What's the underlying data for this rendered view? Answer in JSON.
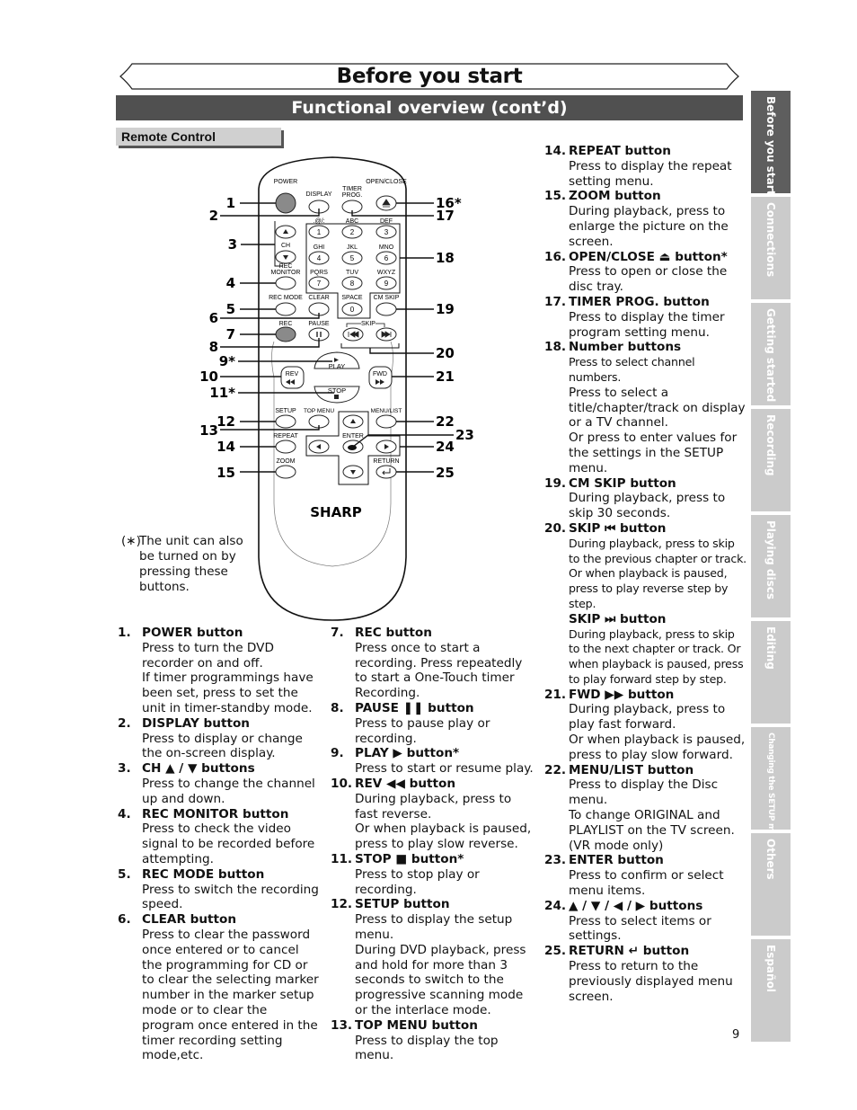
{
  "page": {
    "title": "Before you start",
    "subtitle": "Functional overview (cont’d)",
    "section_label": "Remote Control",
    "page_number": "9"
  },
  "side_tabs": [
    {
      "label": "Before you start",
      "active": true
    },
    {
      "label": "Connections",
      "active": false
    },
    {
      "label": "Getting started",
      "active": false
    },
    {
      "label": "Recording",
      "active": false
    },
    {
      "label": "Playing discs",
      "active": false
    },
    {
      "label": "Editing",
      "active": false
    },
    {
      "label": "Changing the SETUP menu",
      "active": false
    },
    {
      "label": "Others",
      "active": false
    },
    {
      "label": "Español",
      "active": false
    }
  ],
  "remote": {
    "brand": "SHARP",
    "labels": {
      "power": "POWER",
      "display": "DISPLAY",
      "timer": "TIMER",
      "prog": "PROG.",
      "open_close": "OPEN/CLOSE",
      "ch": "CH",
      "rec_monitor_1": "REC",
      "rec_monitor_2": "MONITOR",
      "rec_mode": "REC MODE",
      "clear": "CLEAR",
      "space": "SPACE",
      "cm_skip": "CM SKIP",
      "rec": "REC",
      "pause": "PAUSE",
      "skip": "SKIP",
      "play": "PLAY",
      "rev": "REV",
      "fwd": "FWD",
      "stop": "STOP",
      "setup": "SETUP",
      "top_menu": "TOP MENU",
      "menu_list": "MENU/LIST",
      "repeat": "REPEAT",
      "enter": "ENTER",
      "zoom": "ZOOM",
      "return": "RETURN"
    },
    "keypad": [
      {
        "digit": "1",
        "letters": ".@/:"
      },
      {
        "digit": "2",
        "letters": "ABC"
      },
      {
        "digit": "3",
        "letters": "DEF"
      },
      {
        "digit": "4",
        "letters": "GHI"
      },
      {
        "digit": "5",
        "letters": "JKL"
      },
      {
        "digit": "6",
        "letters": "MNO"
      },
      {
        "digit": "7",
        "letters": "PQRS"
      },
      {
        "digit": "8",
        "letters": "TUV"
      },
      {
        "digit": "9",
        "letters": "WXYZ"
      },
      {
        "digit": "0",
        "letters": "SPACE"
      }
    ],
    "callouts_left": [
      "1",
      "2",
      "3",
      "4",
      "5",
      "6",
      "7",
      "8",
      "9*",
      "10",
      "11*",
      "12",
      "13",
      "14",
      "15"
    ],
    "callouts_right": [
      "16*",
      "17",
      "18",
      "19",
      "20",
      "21",
      "22",
      "23",
      "24",
      "25"
    ]
  },
  "footnote": {
    "mark": "(∗)",
    "text": "The unit can also be turned on by pressing these buttons."
  },
  "items": [
    {
      "num": "1.",
      "head": "POWER button",
      "desc": [
        "Press to turn the DVD recorder on and off.",
        "If timer programmings have been set, press to set the unit in timer-standby mode."
      ]
    },
    {
      "num": "2.",
      "head": "DISPLAY button",
      "desc": [
        "Press to display or change the on-screen display."
      ]
    },
    {
      "num": "3.",
      "head": "CH ▲ / ▼ buttons",
      "desc": [
        "Press to change the channel up and down."
      ]
    },
    {
      "num": "4.",
      "head": "REC MONITOR button",
      "desc": [
        "Press to check the video signal to be recorded before attempting."
      ]
    },
    {
      "num": "5.",
      "head": "REC MODE button",
      "desc": [
        "Press to switch the recording speed."
      ]
    },
    {
      "num": "6.",
      "head": "CLEAR button",
      "desc": [
        "Press to clear the password once entered or to cancel the programming for CD or to clear the selecting marker number in the marker setup mode or to clear the program once entered in the timer recording setting mode,etc."
      ]
    },
    {
      "num": "7.",
      "head": "REC button",
      "desc": [
        "Press once to start a recording. Press repeatedly to start a One-Touch timer Recording."
      ]
    },
    {
      "num": "8.",
      "head": "PAUSE ❚❚ button",
      "desc": [
        "Press to pause play or recording."
      ]
    },
    {
      "num": "9.",
      "head": "PLAY ▶ button*",
      "desc": [
        "Press to start or resume play."
      ]
    },
    {
      "num": "10.",
      "head": "REV ◀◀ button",
      "desc": [
        "During playback, press to fast reverse.",
        "Or when playback is paused, press to play slow reverse."
      ]
    },
    {
      "num": "11.",
      "head": "STOP ■ button*",
      "desc": [
        "Press to stop play or recording."
      ]
    },
    {
      "num": "12.",
      "head": "SETUP button",
      "desc": [
        "Press to display the setup menu.",
        "During DVD playback, press and hold for more than 3 seconds to switch to the progressive scanning mode or the interlace mode."
      ]
    },
    {
      "num": "13.",
      "head": "TOP MENU button",
      "desc": [
        "Press to display the top menu."
      ]
    },
    {
      "num": "14.",
      "head": "REPEAT button",
      "desc": [
        "Press to display the repeat setting menu."
      ]
    },
    {
      "num": "15.",
      "head": "ZOOM button",
      "desc": [
        "During playback, press to enlarge the picture on the screen."
      ]
    },
    {
      "num": "16.",
      "head": "OPEN/CLOSE ⏏ button*",
      "desc": [
        "Press to open or close the disc tray."
      ]
    },
    {
      "num": "17.",
      "head": "TIMER PROG. button",
      "desc": [
        "Press to display the timer program setting menu."
      ]
    },
    {
      "num": "18.",
      "head": "Number buttons",
      "desc_small": "Press to select channel numbers.",
      "desc": [
        "Press to select a title/chapter/track on display or a TV channel.",
        "Or press to enter values for the settings in the SETUP menu."
      ]
    },
    {
      "num": "19.",
      "head": "CM SKIP button",
      "desc": [
        "During playback, press to skip 30 seconds."
      ]
    },
    {
      "num": "20.",
      "head": "SKIP ⏮ button",
      "desc_small": "During playback, press to skip to the previous chapter or track. Or when playback is paused, press to play reverse step by step.",
      "sub_head": "SKIP ⏭ button",
      "sub_desc_small": "During playback, press to skip to the next chapter or track. Or when playback is paused, press to play forward step by step."
    },
    {
      "num": "21.",
      "head": "FWD ▶▶ button",
      "desc": [
        "During playback, press to play fast forward.",
        "Or when playback is paused, press to play slow forward."
      ]
    },
    {
      "num": "22.",
      "head": "MENU/LIST button",
      "desc": [
        "Press to display the Disc menu.",
        "To change ORIGINAL and PLAYLIST on the TV screen. (VR mode only)"
      ]
    },
    {
      "num": "23.",
      "head": "ENTER button",
      "desc": [
        "Press to confirm or select menu items."
      ]
    },
    {
      "num": "24.",
      "head": "▲ / ▼ / ◀ / ▶ buttons",
      "desc": [
        "Press to select items or settings."
      ]
    },
    {
      "num": "25.",
      "head": "RETURN ↵ button",
      "desc": [
        "Press to return to the previously displayed menu screen."
      ]
    }
  ]
}
